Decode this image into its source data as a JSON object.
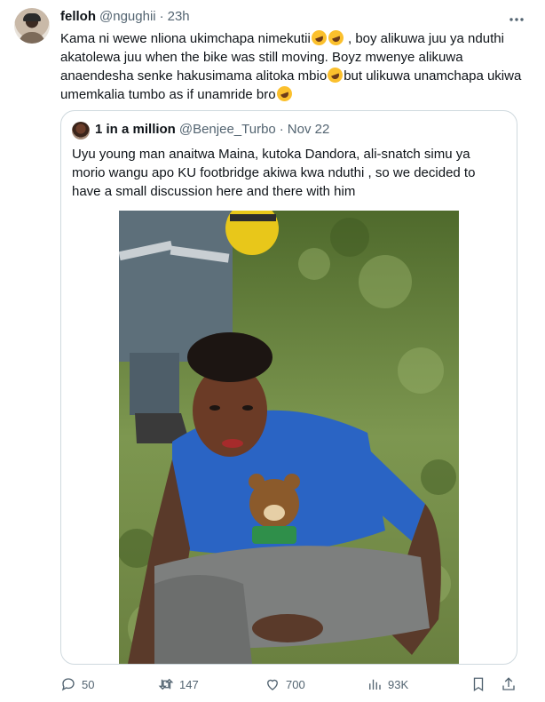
{
  "tweet": {
    "display_name": "felloh",
    "handle": "@ngughii",
    "separator": "·",
    "time": "23h",
    "text_part1": "Kama ni wewe nliona ukimchapa nimekutii",
    "text_part2": " , boy alikuwa juu ya nduthi akatolewa juu when the bike was still moving. Boyz mwenye alikuwa anaendesha senke hakusimama alitoka mbio",
    "text_part3": "but ulikuwa unamchapa ukiwa umemkalia tumbo as if unamride bro",
    "more_icon": "ellipsis-icon"
  },
  "quote": {
    "display_name": "1 in a million",
    "handle": "@Benjee_Turbo",
    "separator": "·",
    "time": "Nov 22",
    "text": "Uyu young man anaitwa Maina, kutoka Dandora, ali-snatch simu ya morio wangu apo KU footbridge akiwa kwa nduthi , so we decided to have a small discussion here and there with him"
  },
  "actions": {
    "replies": "50",
    "retweets": "147",
    "likes": "700",
    "views": "93K"
  },
  "colors": {
    "text_primary": "#0f1419",
    "text_secondary": "#536471",
    "border": "#cfd9de"
  }
}
